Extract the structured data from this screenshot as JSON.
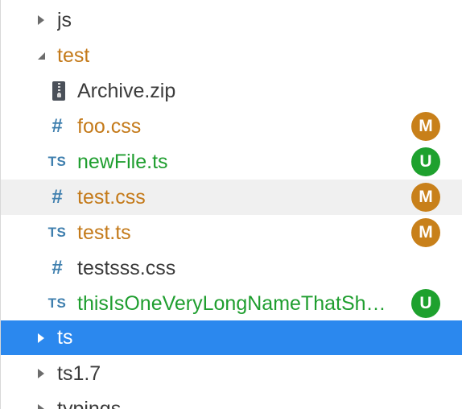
{
  "explorer": {
    "items": [
      {
        "label": "js",
        "kind": "folder",
        "state": "collapsed",
        "status": "default"
      },
      {
        "label": "test",
        "kind": "folder",
        "state": "expanded",
        "status": "modified"
      },
      {
        "label": "Archive.zip",
        "kind": "file",
        "icon": "zip-file-icon",
        "status": "default"
      },
      {
        "label": "foo.css",
        "kind": "file",
        "icon": "css-hash-icon",
        "icon_text": "#",
        "status": "modified",
        "badge": "M"
      },
      {
        "label": "newFile.ts",
        "kind": "file",
        "icon": "typescript-icon",
        "icon_text": "TS",
        "status": "untracked",
        "badge": "U"
      },
      {
        "label": "test.css",
        "kind": "file",
        "icon": "css-hash-icon",
        "icon_text": "#",
        "status": "modified",
        "badge": "M"
      },
      {
        "label": "test.ts",
        "kind": "file",
        "icon": "typescript-icon",
        "icon_text": "TS",
        "status": "modified",
        "badge": "M"
      },
      {
        "label": "testsss.css",
        "kind": "file",
        "icon": "css-hash-icon",
        "icon_text": "#",
        "status": "default"
      },
      {
        "label": "thisIsOneVeryLongNameThatSh…",
        "kind": "file",
        "icon": "typescript-icon",
        "icon_text": "TS",
        "status": "untracked",
        "badge": "U"
      },
      {
        "label": "ts",
        "kind": "folder",
        "state": "collapsed",
        "status": "selected"
      },
      {
        "label": "ts1.7",
        "kind": "folder",
        "state": "collapsed",
        "status": "default"
      },
      {
        "label": "typings",
        "kind": "folder",
        "state": "collapsed",
        "status": "default"
      }
    ]
  },
  "colors": {
    "modified": "#c47a1a",
    "untracked": "#1f9e2f",
    "selection": "#2b88ee",
    "icon_blue": "#3f7fae"
  }
}
